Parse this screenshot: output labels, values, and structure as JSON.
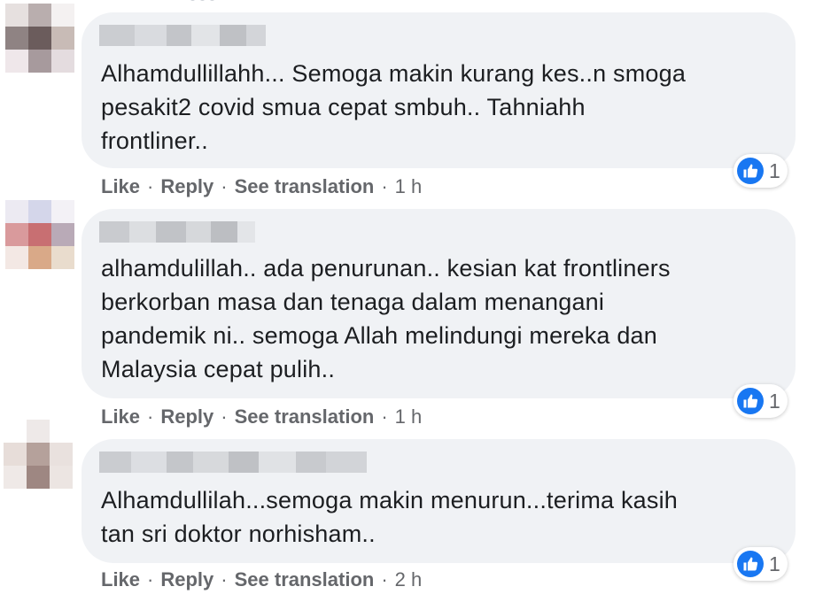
{
  "comments": [
    {
      "text": "Alhamdullillahh... Semoga makin kurang kes..n smoga\npesakit2 covid smua cepat smbuh.. Tahniahh\nfrontliner..",
      "like_label": "Like",
      "reply_label": "Reply",
      "translate_label": "See translation",
      "time": "1 h",
      "reactions": "1",
      "reaction_icon": "like-icon"
    },
    {
      "text": "alhamdulillah.. ada penurunan.. kesian kat frontliners\nberkorban masa dan tenaga dalam menangani\npandemik ni.. semoga Allah melindungi mereka dan\nMalaysia cepat pulih..",
      "like_label": "Like",
      "reply_label": "Reply",
      "translate_label": "See translation",
      "time": "1 h",
      "reactions": "1",
      "reaction_icon": "like-icon"
    },
    {
      "text": "Alhamdullilah...semoga makin menurun...terima kasih\ntan sri doktor norhisham..",
      "like_label": "Like",
      "reply_label": "Reply",
      "translate_label": "See translation",
      "time": "2 h",
      "reactions": "1",
      "reaction_icon": "like-icon"
    }
  ],
  "separator": "·",
  "colors": {
    "bubble": "#f0f2f5",
    "text": "#1c1e21",
    "meta": "#65676b",
    "like_blue": "#1877f2"
  }
}
